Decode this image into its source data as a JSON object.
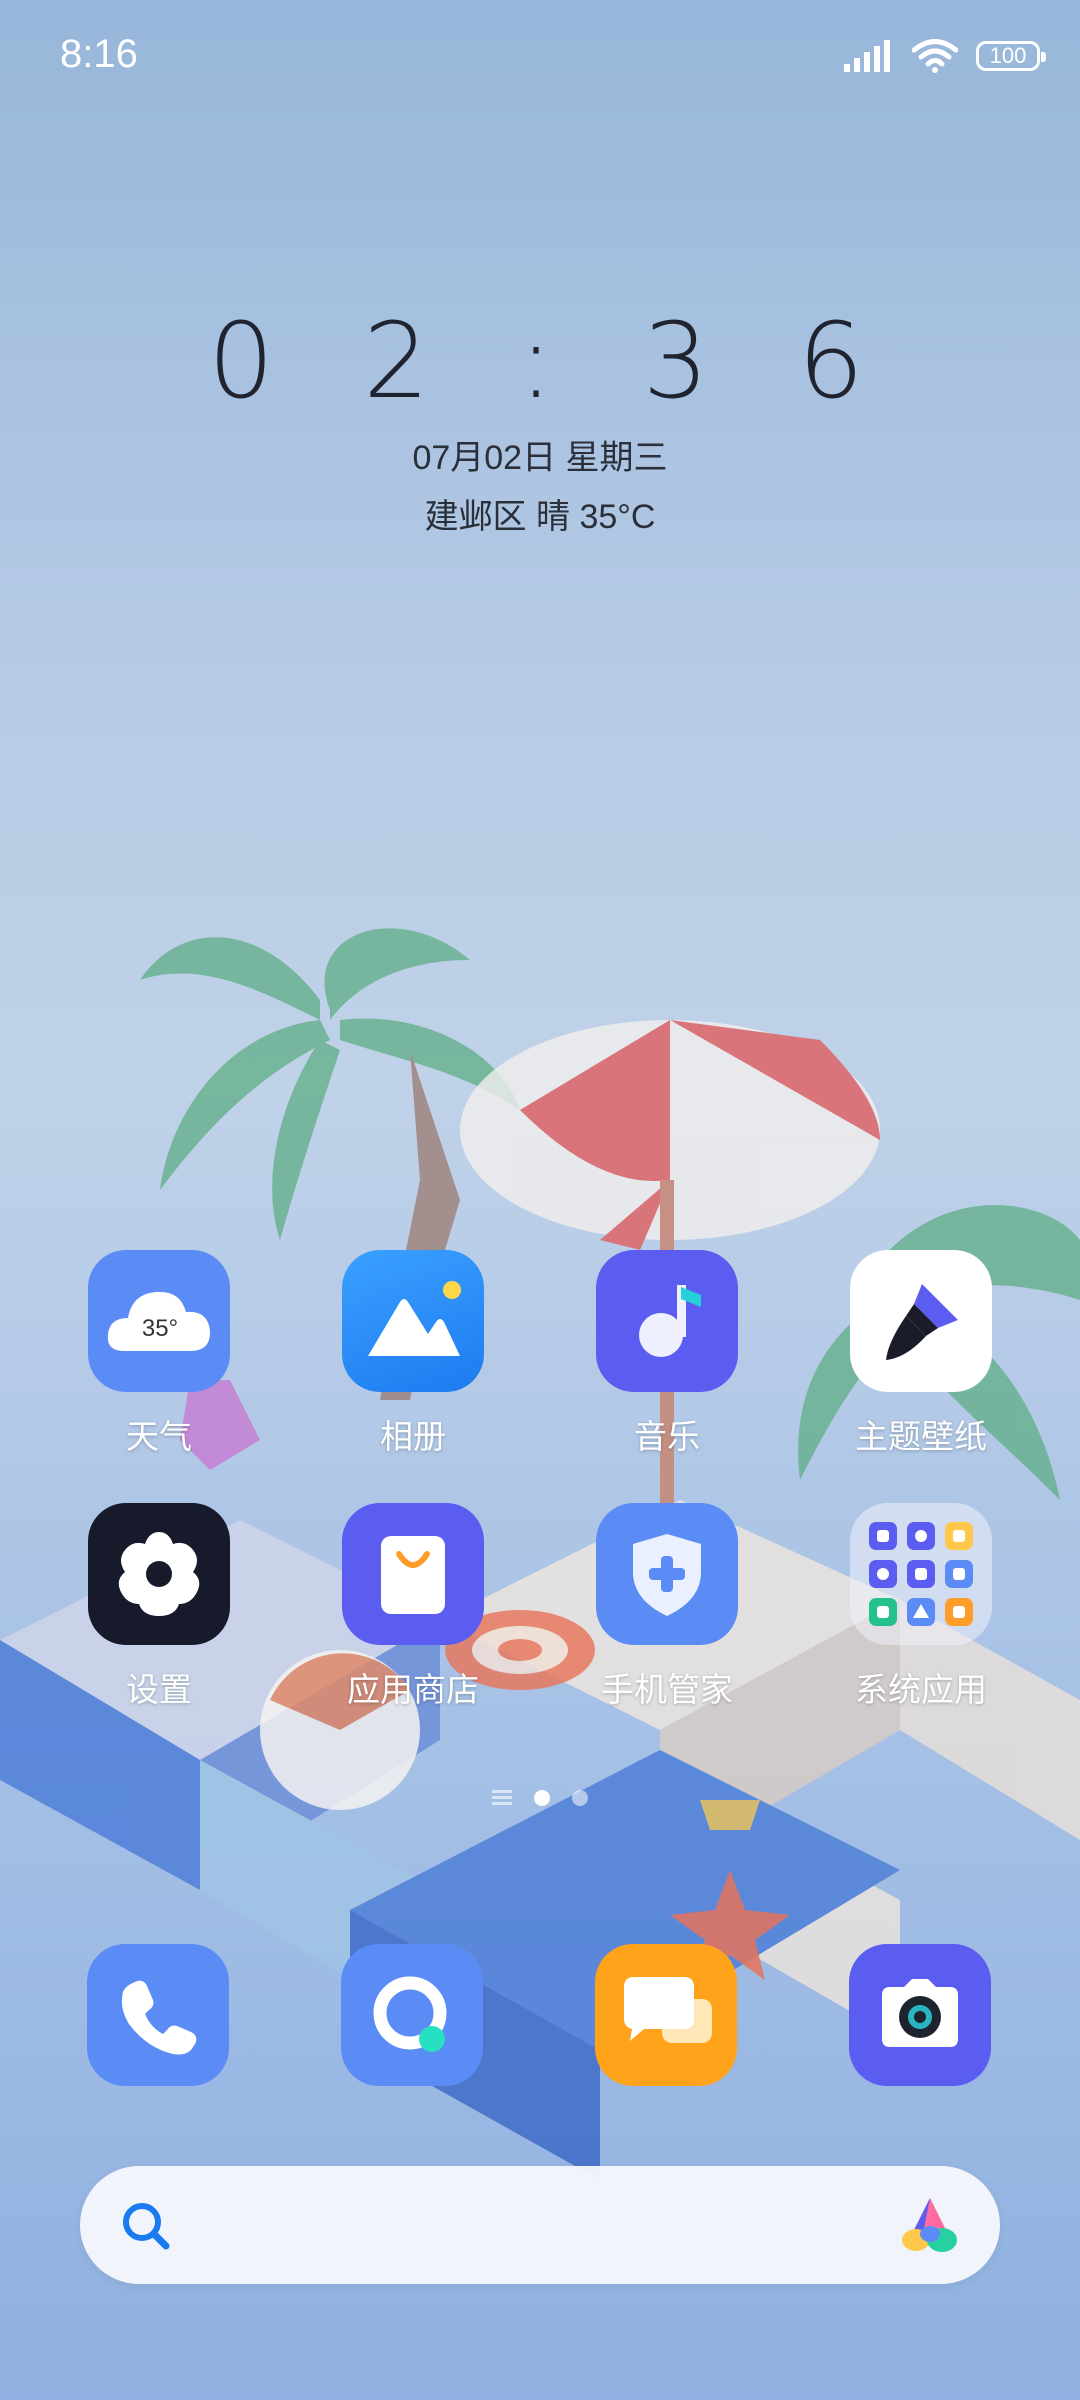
{
  "status_bar": {
    "time": "8:16",
    "battery": "100"
  },
  "clock_widget": {
    "time": "0 2 : 3 6",
    "date": "07月02日 星期三",
    "weather": "建邺区 晴 35°C"
  },
  "apps": [
    {
      "label": "天气",
      "icon": "weather-icon",
      "temp": "35°"
    },
    {
      "label": "相册",
      "icon": "gallery-icon"
    },
    {
      "label": "音乐",
      "icon": "music-icon"
    },
    {
      "label": "主题壁纸",
      "icon": "theme-brush-icon"
    },
    {
      "label": "设置",
      "icon": "settings-gear-icon"
    },
    {
      "label": "应用商店",
      "icon": "app-store-bag-icon"
    },
    {
      "label": "手机管家",
      "icon": "phone-manager-shield-icon"
    },
    {
      "label": "系统应用",
      "icon": "system-apps-folder-icon"
    }
  ],
  "page_indicator": {
    "count": 2,
    "active": 0
  },
  "dock": [
    {
      "icon": "phone-icon"
    },
    {
      "icon": "browser-icon"
    },
    {
      "icon": "messages-icon"
    },
    {
      "icon": "camera-icon"
    }
  ],
  "colors": {
    "blue": "#5b8cf5",
    "purple": "#5b5cf0",
    "orange": "#ffa31a",
    "dark": "#161a2b"
  }
}
